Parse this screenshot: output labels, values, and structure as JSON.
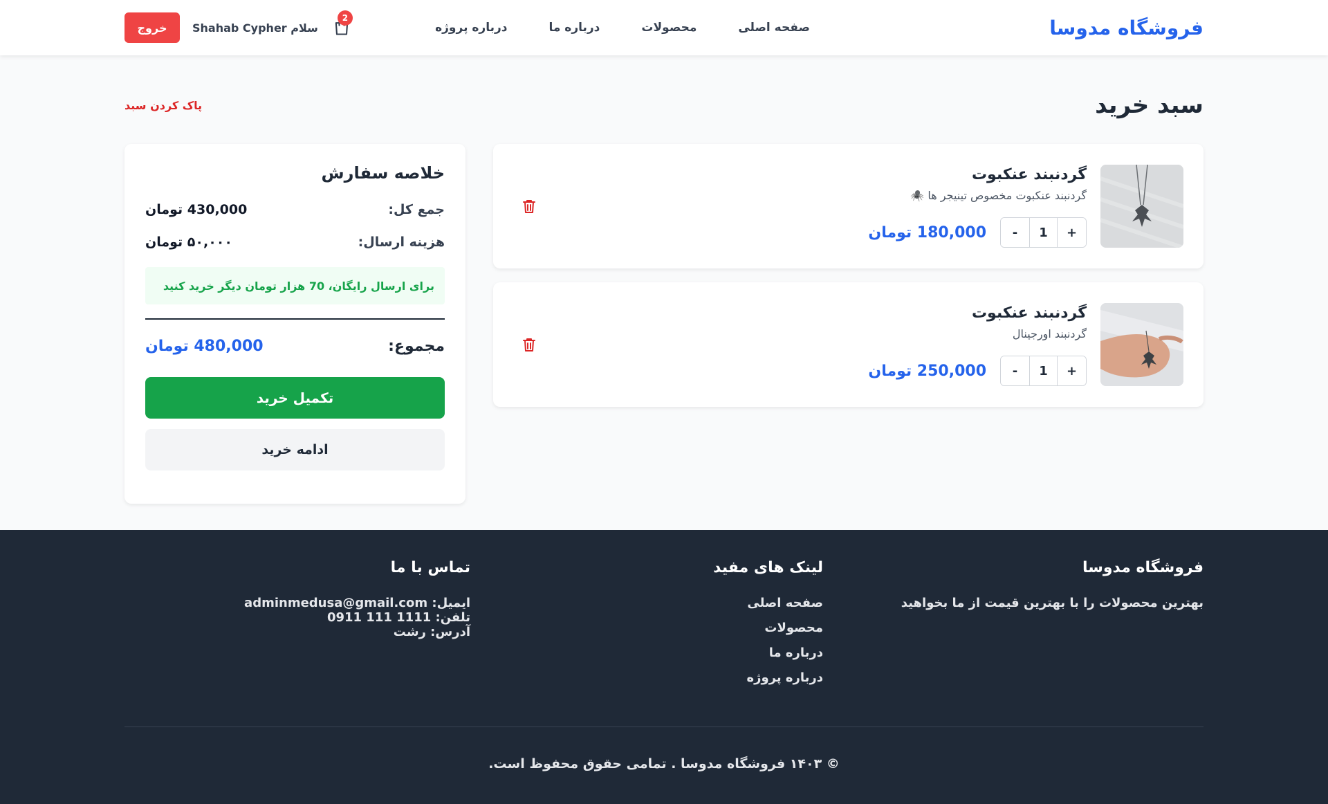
{
  "header": {
    "brand": "فروشگاه مدوسا",
    "nav": [
      "صفحه اصلی",
      "محصولات",
      "درباره ما",
      "درباره پروژه"
    ],
    "cart_count": "2",
    "greeting": "سلام Shahab Cypher",
    "logout_label": "خروج"
  },
  "page": {
    "title": "سبد خرید",
    "clear_label": "پاک کردن سبد"
  },
  "cart": {
    "items": [
      {
        "name": "گردنبند عنکبوت",
        "description": "گردنبند عنکبوت مخصوص تینیجر ها 🕷️",
        "quantity": "1",
        "price": "180,000 تومان",
        "decrement": "-",
        "increment": "+"
      },
      {
        "name": "گردنبند عنکبوت",
        "description": "گردنبند اورجینال",
        "quantity": "1",
        "price": "250,000 تومان",
        "decrement": "-",
        "increment": "+"
      }
    ]
  },
  "summary": {
    "title": "خلاصه سفارش",
    "subtotal_label": "جمع کل:",
    "subtotal_value": "430,000 تومان",
    "shipping_label": "هزینه ارسال:",
    "shipping_value": "۵۰,۰۰۰ تومان",
    "free_shipping_note": "برای ارسال رایگان، 70 هزار تومان دیگر خرید کنید",
    "total_label": "مجموع:",
    "total_value": "480,000 تومان",
    "checkout_label": "تکمیل خرید",
    "continue_label": "ادامه خرید"
  },
  "footer": {
    "about_title": "فروشگاه مدوسا",
    "about_text": "بهترین محصولات را با بهترین قیمت از ما بخواهید",
    "links_title": "لینک های مفید",
    "links": [
      "صفحه اصلی",
      "محصولات",
      "درباره ما",
      "درباره پروژه"
    ],
    "contact_title": "تماس با ما",
    "email_label": "ایمیل:",
    "email": "adminmedusa@gmail.com",
    "phone_label": "تلفن:",
    "phone": "0911 111 1111",
    "address": "آدرس: رشت",
    "copyright": "© ۱۴۰۳ فروشگاه مدوسا . تمامی حقوق محفوظ است."
  },
  "colors": {
    "brand": "#2563eb",
    "danger": "#ef4444",
    "success": "#16a34a",
    "footer_bg": "#1f2937"
  }
}
